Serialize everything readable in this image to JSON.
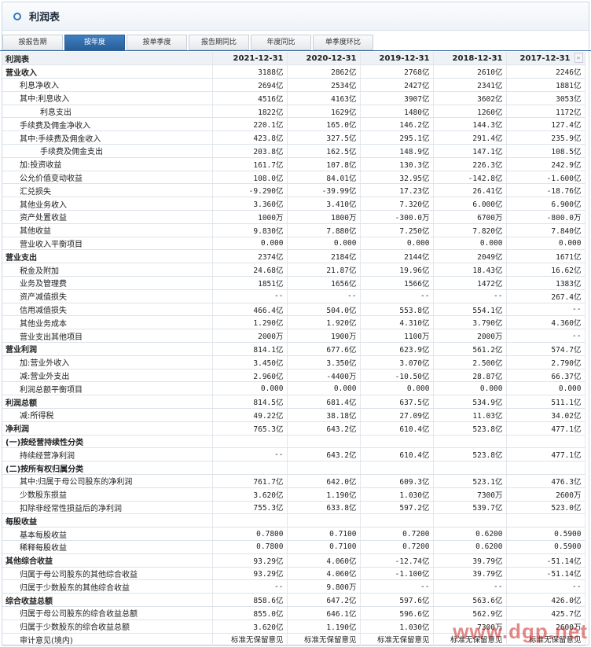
{
  "window": {
    "title": "利润表"
  },
  "tabs": [
    {
      "label": "按报告期",
      "active": false
    },
    {
      "label": "按年度",
      "active": true
    },
    {
      "label": "按单季度",
      "active": false
    },
    {
      "label": "报告期同比",
      "active": false
    },
    {
      "label": "年度同比",
      "active": false
    },
    {
      "label": "单季度环比",
      "active": false
    }
  ],
  "table": {
    "header_label": "利润表",
    "columns": [
      "2021-12-31",
      "2020-12-31",
      "2019-12-31",
      "2018-12-31",
      "2017-12-31"
    ],
    "rows": [
      {
        "level": 0,
        "label": "营业收入",
        "values": [
          "3188亿",
          "2862亿",
          "2768亿",
          "2610亿",
          "2246亿"
        ]
      },
      {
        "level": 1,
        "label": "利息净收入",
        "values": [
          "2694亿",
          "2534亿",
          "2427亿",
          "2341亿",
          "1881亿"
        ]
      },
      {
        "level": 1,
        "label": "其中:利息收入",
        "values": [
          "4516亿",
          "4163亿",
          "3907亿",
          "3602亿",
          "3053亿"
        ]
      },
      {
        "level": 2,
        "label": "利息支出",
        "values": [
          "1822亿",
          "1629亿",
          "1480亿",
          "1260亿",
          "1172亿"
        ]
      },
      {
        "level": 1,
        "label": "手续费及佣金净收入",
        "values": [
          "220.1亿",
          "165.0亿",
          "146.2亿",
          "144.3亿",
          "127.4亿"
        ]
      },
      {
        "level": 1,
        "label": "其中:手续费及佣金收入",
        "values": [
          "423.8亿",
          "327.5亿",
          "295.1亿",
          "291.4亿",
          "235.9亿"
        ]
      },
      {
        "level": 2,
        "label": "手续费及佣金支出",
        "values": [
          "203.8亿",
          "162.5亿",
          "148.9亿",
          "147.1亿",
          "108.5亿"
        ]
      },
      {
        "level": 1,
        "label": "加:投资收益",
        "values": [
          "161.7亿",
          "107.8亿",
          "130.3亿",
          "226.3亿",
          "242.9亿"
        ]
      },
      {
        "level": 1,
        "label": "公允价值变动收益",
        "values": [
          "108.0亿",
          "84.01亿",
          "32.95亿",
          "-142.8亿",
          "-1.600亿"
        ]
      },
      {
        "level": 1,
        "label": "汇兑损失",
        "values": [
          "-9.290亿",
          "-39.99亿",
          "17.23亿",
          "26.41亿",
          "-18.76亿"
        ]
      },
      {
        "level": 1,
        "label": "其他业务收入",
        "values": [
          "3.360亿",
          "3.410亿",
          "7.320亿",
          "6.000亿",
          "6.900亿"
        ]
      },
      {
        "level": 1,
        "label": "资产处置收益",
        "values": [
          "1000万",
          "1800万",
          "-300.0万",
          "6700万",
          "-800.0万"
        ]
      },
      {
        "level": 1,
        "label": "其他收益",
        "values": [
          "9.830亿",
          "7.880亿",
          "7.250亿",
          "7.820亿",
          "7.840亿"
        ]
      },
      {
        "level": 1,
        "label": "营业收入平衡项目",
        "values": [
          "0.000",
          "0.000",
          "0.000",
          "0.000",
          "0.000"
        ]
      },
      {
        "level": 0,
        "label": "营业支出",
        "values": [
          "2374亿",
          "2184亿",
          "2144亿",
          "2049亿",
          "1671亿"
        ]
      },
      {
        "level": 1,
        "label": "税金及附加",
        "values": [
          "24.68亿",
          "21.87亿",
          "19.96亿",
          "18.43亿",
          "16.62亿"
        ]
      },
      {
        "level": 1,
        "label": "业务及管理费",
        "values": [
          "1851亿",
          "1656亿",
          "1566亿",
          "1472亿",
          "1383亿"
        ]
      },
      {
        "level": 1,
        "label": "资产减值损失",
        "values": [
          "--",
          "--",
          "--",
          "--",
          "267.4亿"
        ]
      },
      {
        "level": 1,
        "label": "信用减值损失",
        "values": [
          "466.4亿",
          "504.0亿",
          "553.8亿",
          "554.1亿",
          "--"
        ]
      },
      {
        "level": 1,
        "label": "其他业务成本",
        "values": [
          "1.290亿",
          "1.920亿",
          "4.310亿",
          "3.790亿",
          "4.360亿"
        ]
      },
      {
        "level": 1,
        "label": "营业支出其他项目",
        "values": [
          "2000万",
          "1900万",
          "1100万",
          "2000万",
          "--"
        ]
      },
      {
        "level": 0,
        "label": "营业利润",
        "values": [
          "814.1亿",
          "677.6亿",
          "623.9亿",
          "561.2亿",
          "574.7亿"
        ]
      },
      {
        "level": 1,
        "label": "加:营业外收入",
        "values": [
          "3.450亿",
          "3.350亿",
          "3.070亿",
          "2.500亿",
          "2.790亿"
        ]
      },
      {
        "level": 1,
        "label": "减:营业外支出",
        "values": [
          "2.960亿",
          "-4400万",
          "-10.50亿",
          "28.87亿",
          "66.37亿"
        ]
      },
      {
        "level": 1,
        "label": "利润总额平衡项目",
        "values": [
          "0.000",
          "0.000",
          "0.000",
          "0.000",
          "0.000"
        ]
      },
      {
        "level": 0,
        "label": "利润总额",
        "values": [
          "814.5亿",
          "681.4亿",
          "637.5亿",
          "534.9亿",
          "511.1亿"
        ]
      },
      {
        "level": 1,
        "label": "减:所得税",
        "values": [
          "49.22亿",
          "38.18亿",
          "27.09亿",
          "11.03亿",
          "34.02亿"
        ]
      },
      {
        "level": 0,
        "label": "净利润",
        "values": [
          "765.3亿",
          "643.2亿",
          "610.4亿",
          "523.8亿",
          "477.1亿"
        ]
      },
      {
        "level": 0,
        "label": "(一)按经营持续性分类",
        "values": [
          "",
          "",
          "",
          "",
          ""
        ]
      },
      {
        "level": 1,
        "label": "持续经营净利润",
        "values": [
          "--",
          "643.2亿",
          "610.4亿",
          "523.8亿",
          "477.1亿"
        ]
      },
      {
        "level": 0,
        "label": "(二)按所有权归属分类",
        "values": [
          "",
          "",
          "",
          "",
          ""
        ]
      },
      {
        "level": 1,
        "label": "其中:归属于母公司股东的净利润",
        "values": [
          "761.7亿",
          "642.0亿",
          "609.3亿",
          "523.1亿",
          "476.3亿"
        ]
      },
      {
        "level": 1,
        "label": "少数股东损益",
        "values": [
          "3.620亿",
          "1.190亿",
          "1.030亿",
          "7300万",
          "2600万"
        ]
      },
      {
        "level": 1,
        "label": "扣除非经常性损益后的净利润",
        "values": [
          "755.3亿",
          "633.8亿",
          "597.2亿",
          "539.7亿",
          "523.0亿"
        ]
      },
      {
        "level": 0,
        "label": "每股收益",
        "values": [
          "",
          "",
          "",
          "",
          ""
        ]
      },
      {
        "level": 1,
        "label": "基本每股收益",
        "values": [
          "0.7800",
          "0.7100",
          "0.7200",
          "0.6200",
          "0.5900"
        ]
      },
      {
        "level": 1,
        "label": "稀释每股收益",
        "values": [
          "0.7800",
          "0.7100",
          "0.7200",
          "0.6200",
          "0.5900"
        ]
      },
      {
        "level": 0,
        "label": "其他综合收益",
        "values": [
          "93.29亿",
          "4.060亿",
          "-12.74亿",
          "39.79亿",
          "-51.14亿"
        ]
      },
      {
        "level": 1,
        "label": "归属于母公司股东的其他综合收益",
        "values": [
          "93.29亿",
          "4.060亿",
          "-1.100亿",
          "39.79亿",
          "-51.14亿"
        ]
      },
      {
        "level": 1,
        "label": "归属于少数股东的其他综合收益",
        "values": [
          "--",
          "9.800万",
          "--",
          "--",
          "--"
        ]
      },
      {
        "level": 0,
        "label": "综合收益总额",
        "values": [
          "858.6亿",
          "647.2亿",
          "597.6亿",
          "563.6亿",
          "426.0亿"
        ]
      },
      {
        "level": 1,
        "label": "归属于母公司股东的综合收益总额",
        "values": [
          "855.0亿",
          "646.1亿",
          "596.6亿",
          "562.9亿",
          "425.7亿"
        ]
      },
      {
        "level": 1,
        "label": "归属于少数股东的综合收益总额",
        "values": [
          "3.620亿",
          "1.190亿",
          "1.030亿",
          "7300万",
          "2600万"
        ]
      },
      {
        "level": 1,
        "label": "审计意见(境内)",
        "values": [
          "标准无保留意见",
          "标准无保留意见",
          "标准无保留意见",
          "标准无保留意见",
          "标准无保留意见"
        ]
      }
    ]
  },
  "watermark": "www.dgp.net",
  "scroll_arrow": "»"
}
